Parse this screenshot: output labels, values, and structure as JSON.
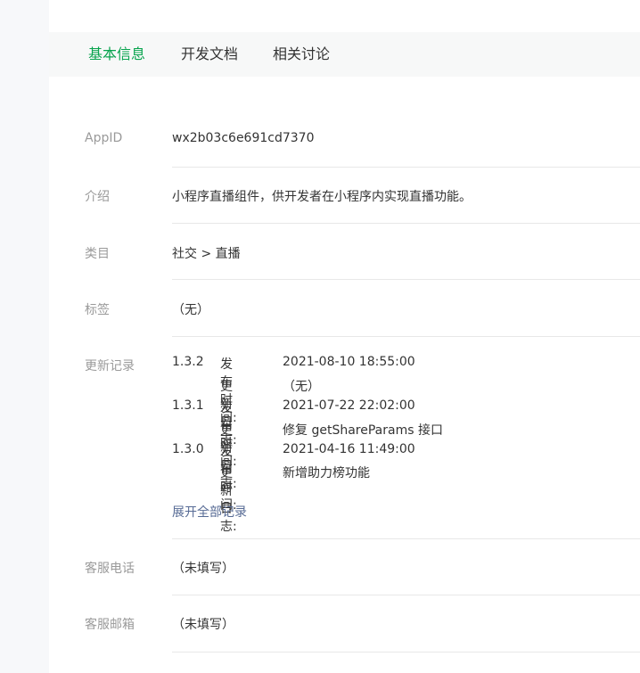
{
  "tabs": [
    {
      "label": "基本信息",
      "active": true
    },
    {
      "label": "开发文档",
      "active": false
    },
    {
      "label": "相关讨论",
      "active": false
    }
  ],
  "fields": {
    "appid": {
      "label": "AppID",
      "value": "wx2b03c6e691cd7370"
    },
    "intro": {
      "label": "介绍",
      "value": "小程序直播组件，供开发者在小程序内实现直播功能。"
    },
    "category": {
      "label": "类目",
      "value": "社交 > 直播"
    },
    "tags": {
      "label": "标签",
      "value": "（无）"
    },
    "changelog": {
      "label": "更新记录"
    },
    "phone": {
      "label": "客服电话",
      "value": "（未填写）"
    },
    "email": {
      "label": "客服邮箱",
      "value": "（未填写）"
    }
  },
  "changelog": {
    "publish_label": "发布时间:",
    "log_label": "更新日志:",
    "entries": [
      {
        "version": "1.3.2",
        "time": "2021-08-10 18:55:00",
        "log": "（无）"
      },
      {
        "version": "1.3.1",
        "time": "2021-07-22 22:02:00",
        "log": "修复 getShareParams 接口"
      },
      {
        "version": "1.3.0",
        "time": "2021-04-16 11:49:00",
        "log": "新增助力榜功能"
      }
    ],
    "expand_label": "展开全部记录"
  },
  "colors": {
    "accent": "#07a34d",
    "link": "#576b95"
  }
}
